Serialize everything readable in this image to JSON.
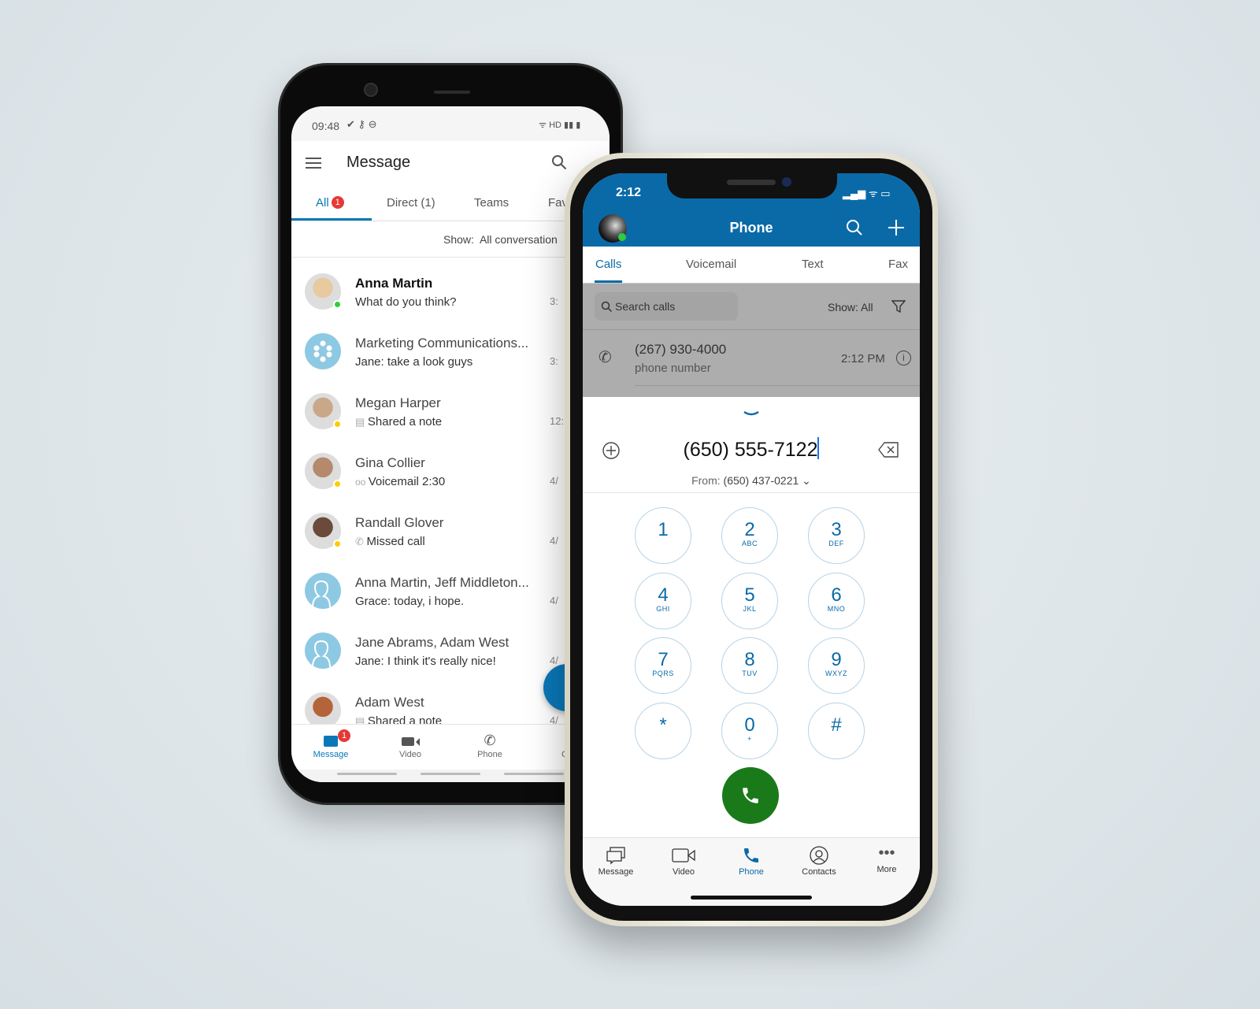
{
  "android": {
    "status": {
      "time": "09:48",
      "net": "HD"
    },
    "title": "Message",
    "tabs": [
      {
        "label": "All",
        "badge": "1"
      },
      {
        "label": "Direct (1)"
      },
      {
        "label": "Teams"
      },
      {
        "label": "Fav"
      }
    ],
    "show_label": "Show:",
    "show_value": "All conversation",
    "conversations": [
      {
        "name": "Anna Martin",
        "preview": "What do you think?",
        "time": "3:",
        "status": "online",
        "icon": "",
        "bold": true
      },
      {
        "name": "Marketing Communications...",
        "preview": "Jane: take a look guys",
        "time": "3:",
        "status": "",
        "icon": ""
      },
      {
        "name": "Megan Harper",
        "preview": "Shared a note",
        "time": "12:",
        "status": "away",
        "icon": "note-icon"
      },
      {
        "name": "Gina Collier",
        "preview": "Voicemail  2:30",
        "time": "4/",
        "status": "away",
        "icon": "voicemail-icon"
      },
      {
        "name": "Randall Glover",
        "preview": "Missed call",
        "time": "4/",
        "status": "away",
        "icon": "missed-call-icon"
      },
      {
        "name": "Anna Martin, Jeff Middleton...",
        "preview": "Grace: today, i hope.",
        "time": "4/",
        "status": "",
        "icon": ""
      },
      {
        "name": "Jane Abrams, Adam West",
        "preview": "Jane: I think it's really nice!",
        "time": "4/",
        "status": "",
        "icon": ""
      },
      {
        "name": "Adam West",
        "preview": "Shared a note",
        "time": "4/",
        "status": "",
        "icon": "note-icon"
      }
    ],
    "nav": [
      {
        "label": "Message",
        "badge": "1",
        "active": true
      },
      {
        "label": "Video"
      },
      {
        "label": "Phone"
      },
      {
        "label": "Co"
      }
    ]
  },
  "iphone": {
    "status": {
      "time": "2:12"
    },
    "title": "Phone",
    "tabs": [
      "Calls",
      "Voicemail",
      "Text",
      "Fax"
    ],
    "search_placeholder": "Search calls",
    "show": "Show: All",
    "recent_call": {
      "number": "(267) 930-4000",
      "label": "phone number",
      "time": "2:12 PM"
    },
    "dial_value": "(650) 555-7122",
    "from_label": "From:",
    "from_number": "(650) 437-0221",
    "keys": [
      [
        "1",
        ""
      ],
      [
        "2",
        "ABC"
      ],
      [
        "3",
        "DEF"
      ],
      [
        "4",
        "GHI"
      ],
      [
        "5",
        "JKL"
      ],
      [
        "6",
        "MNO"
      ],
      [
        "7",
        "PQRS"
      ],
      [
        "8",
        "TUV"
      ],
      [
        "9",
        "WXYZ"
      ],
      [
        "*",
        ""
      ],
      [
        "0",
        "+"
      ],
      [
        "#",
        ""
      ]
    ],
    "nav": [
      {
        "label": "Message"
      },
      {
        "label": "Video"
      },
      {
        "label": "Phone",
        "active": true
      },
      {
        "label": "Contacts"
      },
      {
        "label": "More"
      }
    ]
  },
  "colors": {
    "brand": "#0a6aa8",
    "call_green": "#1a7a1a",
    "online": "#2ecc40",
    "away": "#ffcc00",
    "badge": "#e53935"
  }
}
